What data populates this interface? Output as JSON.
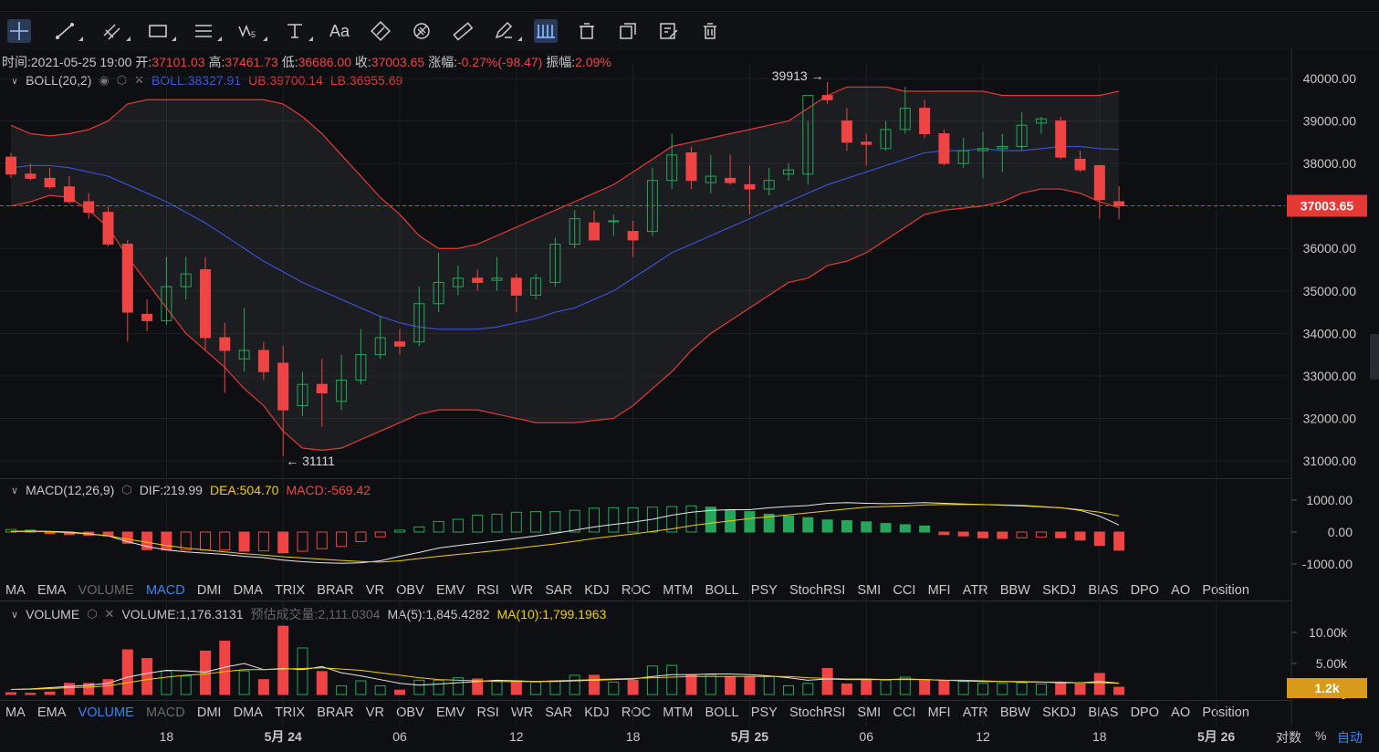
{
  "toolbar": {
    "tools": [
      "crosshair-icon",
      "trend-line-icon",
      "parallel-channel-icon",
      "rectangle-icon",
      "fib-lines-icon",
      "wave-icon",
      "text-tool-icon",
      "font-icon",
      "eraser-icon",
      "hide-drawings-icon",
      "ruler-icon",
      "pen-icon",
      "bars-icon",
      "delete-icon",
      "copy-icon",
      "edit-icon",
      "trash-icon"
    ],
    "font_label": "Aa"
  },
  "info": {
    "time_label": "时间:",
    "time": "2021-05-25 19:00",
    "open_label": "开:",
    "open": "37101.03",
    "high_label": "高:",
    "high": "37461.73",
    "low_label": "低:",
    "low": "36686.00",
    "close_label": "收:",
    "close": "37003.65",
    "change_label": "涨幅:",
    "change": "-0.27%(-98.47)",
    "amp_label": "振幅:",
    "amp": "2.09%"
  },
  "boll": {
    "name": "BOLL(20,2)",
    "mid": "BOLL:38327.91",
    "ub": "UB:39700.14",
    "lb": "LB:36955.69"
  },
  "macd": {
    "name": "MACD(12,26,9)",
    "dif": "DIF:219.99",
    "dea": "DEA:504.70",
    "macd": "MACD:-569.42"
  },
  "volume": {
    "name": "VOLUME",
    "vol": "VOLUME:1,176.3131",
    "est": "预估成交量:2,111.0304",
    "ma5": "MA(5):1,845.4282",
    "ma10": "MA(10):1,799.1963"
  },
  "tabs": [
    "MA",
    "EMA",
    "VOLUME",
    "MACD",
    "DMI",
    "DMA",
    "TRIX",
    "BRAR",
    "VR",
    "OBV",
    "EMV",
    "RSI",
    "WR",
    "SAR",
    "KDJ",
    "ROC",
    "MTM",
    "BOLL",
    "PSY",
    "StochRSI",
    "SMI",
    "CCI",
    "MFI",
    "ATR",
    "BBW",
    "SKDJ",
    "BIAS",
    "DPO",
    "AO",
    "Position"
  ],
  "bottom": {
    "log": "对数",
    "pct": "%",
    "auto": "自动"
  },
  "colors": {
    "up": "#26a65b",
    "down": "#ef4444",
    "boll_band": "#e53935",
    "boll_mid": "#3b4fd0",
    "dif": "#e8e8e8",
    "dea": "#f0d000",
    "price_tag": "#e53935",
    "vol_tag": "#d89a1a"
  },
  "chart_data": {
    "type": "candlestick",
    "price_axis": {
      "ticks": [
        31000,
        32000,
        33000,
        34000,
        35000,
        36000,
        37000,
        38000,
        39000,
        40000
      ],
      "labels": [
        "31000.00",
        "32000.00",
        "33000.00",
        "34000.00",
        "35000.00",
        "36000.00",
        "37000.00",
        "38000.00",
        "39000.00",
        "40000.00"
      ]
    },
    "x_labels": [
      {
        "i": 8,
        "t": "18",
        "bold": false
      },
      {
        "i": 14,
        "t": "5月 24",
        "bold": true
      },
      {
        "i": 20,
        "t": "06",
        "bold": false
      },
      {
        "i": 26,
        "t": "12",
        "bold": false
      },
      {
        "i": 32,
        "t": "18",
        "bold": false
      },
      {
        "i": 38,
        "t": "5月 25",
        "bold": true
      },
      {
        "i": 44,
        "t": "06",
        "bold": false
      },
      {
        "i": 50,
        "t": "12",
        "bold": false
      },
      {
        "i": 56,
        "t": "18",
        "bold": false
      },
      {
        "i": 62,
        "t": "5月 26",
        "bold": true
      }
    ],
    "last_price": 37003.65,
    "last_price_label": "37003.65",
    "max_label": "39913 →",
    "max_index": 42,
    "max_value": 39913,
    "min_label": "← 31111",
    "min_index": 14,
    "min_value": 31111,
    "candles": [
      [
        38150,
        38250,
        37650,
        37750
      ],
      [
        37750,
        38000,
        37600,
        37650
      ],
      [
        37650,
        37900,
        37400,
        37450
      ],
      [
        37450,
        37700,
        37050,
        37100
      ],
      [
        37100,
        37300,
        36700,
        36850
      ],
      [
        36850,
        37000,
        36050,
        36100
      ],
      [
        36100,
        36200,
        33800,
        34500
      ],
      [
        34450,
        34800,
        34050,
        34300
      ],
      [
        34300,
        35800,
        34200,
        35100
      ],
      [
        35100,
        35800,
        34800,
        35400
      ],
      [
        35500,
        35800,
        33600,
        33900
      ],
      [
        33900,
        34250,
        32600,
        33600
      ],
      [
        33400,
        34600,
        33100,
        33600
      ],
      [
        33600,
        33800,
        32900,
        33100
      ],
      [
        33300,
        33700,
        31111,
        32200
      ],
      [
        32300,
        33100,
        32050,
        32800
      ],
      [
        32800,
        33400,
        31800,
        32600
      ],
      [
        32400,
        33500,
        32200,
        32900
      ],
      [
        32900,
        34100,
        32800,
        33500
      ],
      [
        33500,
        34400,
        33400,
        33900
      ],
      [
        33800,
        34100,
        33500,
        33700
      ],
      [
        33800,
        35100,
        33700,
        34700
      ],
      [
        34700,
        35900,
        34500,
        35200
      ],
      [
        35100,
        35600,
        34900,
        35300
      ],
      [
        35300,
        35500,
        35000,
        35200
      ],
      [
        35250,
        35800,
        35000,
        35300
      ],
      [
        35300,
        35400,
        34500,
        34900
      ],
      [
        34900,
        35400,
        34800,
        35300
      ],
      [
        35200,
        36250,
        35100,
        36100
      ],
      [
        36100,
        36900,
        36000,
        36700
      ],
      [
        36600,
        36900,
        36200,
        36200
      ],
      [
        36650,
        36800,
        36300,
        36650
      ],
      [
        36400,
        36650,
        35800,
        36200
      ],
      [
        36400,
        37900,
        36300,
        37600
      ],
      [
        37600,
        38700,
        37400,
        38200
      ],
      [
        38250,
        38400,
        37400,
        37600
      ],
      [
        37550,
        38200,
        37300,
        37700
      ],
      [
        37650,
        38200,
        37500,
        37550
      ],
      [
        37500,
        37950,
        36800,
        37400
      ],
      [
        37400,
        37900,
        37250,
        37600
      ],
      [
        37750,
        38000,
        37600,
        37850
      ],
      [
        37750,
        39000,
        37500,
        39600
      ],
      [
        39600,
        39913,
        39400,
        39500
      ],
      [
        39000,
        39300,
        38300,
        38500
      ],
      [
        38500,
        38700,
        37950,
        38450
      ],
      [
        38350,
        39000,
        38300,
        38800
      ],
      [
        38800,
        39800,
        38700,
        39300
      ],
      [
        39300,
        39500,
        38600,
        38700
      ],
      [
        38700,
        38800,
        37950,
        38000
      ],
      [
        38000,
        38600,
        37900,
        38300
      ],
      [
        38300,
        38750,
        37650,
        38350
      ],
      [
        38350,
        38700,
        37800,
        38400
      ],
      [
        38400,
        39200,
        38300,
        38900
      ],
      [
        38950,
        39100,
        38700,
        39050
      ],
      [
        39000,
        39100,
        38100,
        38150
      ],
      [
        38100,
        38300,
        37800,
        37850
      ],
      [
        37950,
        37950,
        36700,
        37150
      ],
      [
        37100,
        37460,
        36686,
        37003.65
      ]
    ],
    "boll_upper": [
      38900,
      38700,
      38650,
      38700,
      38800,
      39000,
      39400,
      39500,
      39500,
      39500,
      39500,
      39500,
      39500,
      39500,
      39400,
      39100,
      38700,
      38200,
      37700,
      37200,
      36800,
      36300,
      36000,
      36000,
      36100,
      36300,
      36500,
      36700,
      36900,
      37100,
      37300,
      37500,
      37800,
      38100,
      38400,
      38500,
      38600,
      38700,
      38800,
      38900,
      39000,
      39300,
      39600,
      39800,
      39800,
      39800,
      39700,
      39700,
      39700,
      39700,
      39700,
      39600,
      39600,
      39600,
      39600,
      39600,
      39600,
      39700
    ],
    "boll_mid": [
      37900,
      37950,
      37950,
      37900,
      37800,
      37700,
      37500,
      37300,
      37100,
      36850,
      36600,
      36300,
      36000,
      35700,
      35450,
      35200,
      35000,
      34800,
      34600,
      34400,
      34250,
      34150,
      34100,
      34100,
      34100,
      34150,
      34250,
      34350,
      34500,
      34600,
      34800,
      35000,
      35300,
      35600,
      35900,
      36100,
      36300,
      36500,
      36700,
      36900,
      37100,
      37300,
      37500,
      37650,
      37800,
      37950,
      38100,
      38250,
      38300,
      38300,
      38350,
      38300,
      38300,
      38350,
      38400,
      38400,
      38350,
      38330
    ],
    "boll_lower": [
      37000,
      37100,
      37250,
      37200,
      36900,
      36500,
      35800,
      35200,
      34600,
      34000,
      33600,
      33200,
      32700,
      32300,
      31700,
      31300,
      31250,
      31300,
      31500,
      31700,
      31900,
      32100,
      32200,
      32200,
      32200,
      32100,
      32000,
      31900,
      31900,
      31900,
      31950,
      32000,
      32300,
      32700,
      33100,
      33600,
      34000,
      34300,
      34600,
      34900,
      35200,
      35300,
      35600,
      35700,
      35900,
      36200,
      36500,
      36800,
      36900,
      36950,
      37000,
      37100,
      37300,
      37400,
      37400,
      37300,
      37100,
      36956
    ],
    "macd_axis": {
      "ticks": [
        1000,
        0,
        -1000
      ],
      "labels": [
        "1000.00",
        "0.00",
        "-1000.00"
      ]
    },
    "macd_hist": [
      80,
      60,
      -50,
      -80,
      -100,
      -120,
      -350,
      -550,
      -560,
      -560,
      -560,
      -560,
      -600,
      -590,
      -650,
      -600,
      -520,
      -450,
      -300,
      -150,
      60,
      160,
      330,
      400,
      530,
      560,
      620,
      640,
      640,
      680,
      750,
      760,
      760,
      780,
      800,
      820,
      780,
      700,
      640,
      560,
      500,
      450,
      380,
      360,
      320,
      270,
      230,
      190,
      -80,
      -120,
      -180,
      -200,
      -180,
      -160,
      -180,
      -250,
      -420,
      -569
    ],
    "dif": [
      20,
      30,
      20,
      0,
      -50,
      -120,
      -300,
      -450,
      -560,
      -620,
      -660,
      -700,
      -760,
      -800,
      -880,
      -930,
      -960,
      -980,
      -960,
      -900,
      -760,
      -640,
      -500,
      -420,
      -350,
      -280,
      -200,
      -120,
      -40,
      60,
      160,
      240,
      310,
      400,
      530,
      620,
      680,
      700,
      700,
      760,
      800,
      830,
      900,
      920,
      900,
      890,
      900,
      920,
      900,
      880,
      860,
      840,
      820,
      790,
      760,
      680,
      500,
      220
    ],
    "dea": [
      10,
      20,
      10,
      -20,
      -60,
      -120,
      -220,
      -320,
      -420,
      -500,
      -560,
      -620,
      -680,
      -720,
      -770,
      -810,
      -850,
      -890,
      -920,
      -940,
      -900,
      -830,
      -760,
      -700,
      -640,
      -580,
      -510,
      -440,
      -370,
      -290,
      -200,
      -130,
      -60,
      20,
      100,
      200,
      280,
      350,
      420,
      480,
      540,
      600,
      660,
      720,
      780,
      800,
      820,
      850,
      860,
      860,
      860,
      850,
      840,
      800,
      760,
      700,
      620,
      505
    ],
    "vol_axis": {
      "ticks": [
        10000,
        5000,
        0
      ],
      "labels": [
        "10.00k",
        "5.00k",
        "0"
      ]
    },
    "volume": [
      300,
      200,
      400,
      1800,
      1800,
      2400,
      7200,
      5800,
      3800,
      3000,
      7000,
      8600,
      3800,
      2400,
      11000,
      7500,
      3700,
      1400,
      2200,
      1400,
      700,
      2300,
      2300,
      2700,
      2500,
      2200,
      2200,
      2000,
      2200,
      3100,
      3100,
      2000,
      2300,
      4600,
      4700,
      3200,
      3200,
      2900,
      2900,
      2900,
      1400,
      1800,
      4200,
      1700,
      2300,
      2300,
      2800,
      2300,
      2200,
      2100,
      1800,
      1800,
      1900,
      1700,
      1900,
      1700,
      3400,
      1176
    ],
    "vol_ma5": [
      800,
      900,
      1100,
      1300,
      1500,
      1800,
      2800,
      3400,
      3900,
      3800,
      3600,
      4400,
      5000,
      4000,
      4200,
      4000,
      4500,
      3500,
      3000,
      2400,
      1800,
      1500,
      1700,
      1900,
      2100,
      2300,
      2200,
      2100,
      2100,
      2200,
      2300,
      2400,
      2500,
      2900,
      3200,
      3200,
      3300,
      3300,
      3200,
      3000,
      2700,
      2300,
      2500,
      2400,
      2400,
      2400,
      2500,
      2400,
      2300,
      2200,
      2100,
      2100,
      2000,
      2000,
      1900,
      1900,
      2100,
      1845
    ],
    "vol_ma10": [
      800,
      850,
      950,
      1100,
      1200,
      1400,
      1900,
      2400,
      2800,
      3100,
      3300,
      3700,
      4000,
      4000,
      4100,
      4200,
      4300,
      4100,
      3900,
      3500,
      3100,
      2700,
      2400,
      2300,
      2200,
      2100,
      2100,
      2100,
      2200,
      2300,
      2400,
      2500,
      2600,
      2700,
      2800,
      2900,
      2900,
      2900,
      2900,
      2900,
      2900,
      2700,
      2600,
      2500,
      2500,
      2400,
      2400,
      2400,
      2300,
      2300,
      2200,
      2100,
      2100,
      2000,
      2000,
      1900,
      1900,
      1799
    ],
    "vol_last_label": "1.2k"
  }
}
